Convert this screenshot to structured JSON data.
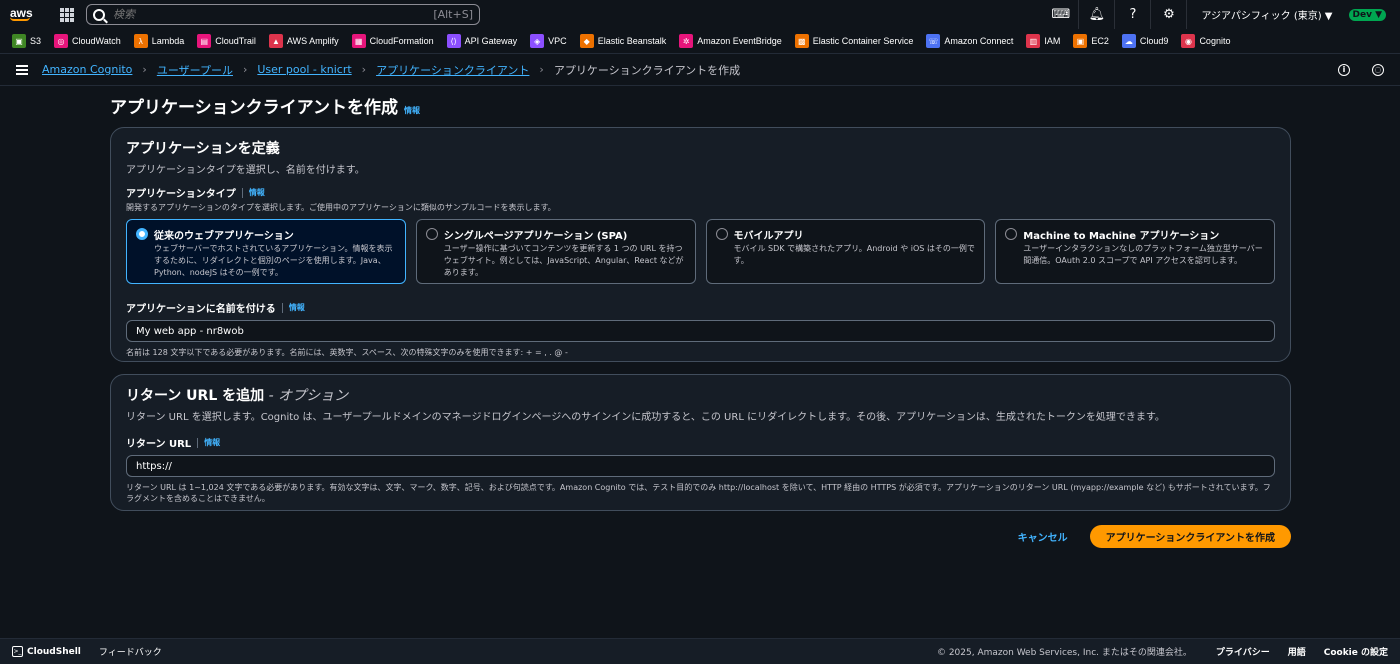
{
  "topnav": {
    "logo": "aws",
    "search_placeholder": "検索",
    "search_shortcut": "[Alt+S]",
    "region": "アジアパシフィック (東京) ▼",
    "account_badge": "Dev ▼"
  },
  "favorites": [
    {
      "label": "S3",
      "color": "#3f8624",
      "glyph": "▣"
    },
    {
      "label": "CloudWatch",
      "color": "#e7157b",
      "glyph": "◎"
    },
    {
      "label": "Lambda",
      "color": "#ed7100",
      "glyph": "λ"
    },
    {
      "label": "CloudTrail",
      "color": "#e7157b",
      "glyph": "▤"
    },
    {
      "label": "AWS Amplify",
      "color": "#dd344c",
      "glyph": "▲"
    },
    {
      "label": "CloudFormation",
      "color": "#e7157b",
      "glyph": "▦"
    },
    {
      "label": "API Gateway",
      "color": "#8c4fff",
      "glyph": "⟨⟩"
    },
    {
      "label": "VPC",
      "color": "#8c4fff",
      "glyph": "◈"
    },
    {
      "label": "Elastic Beanstalk",
      "color": "#ed7100",
      "glyph": "◆"
    },
    {
      "label": "Amazon EventBridge",
      "color": "#e7157b",
      "glyph": "✲"
    },
    {
      "label": "Elastic Container Service",
      "color": "#ed7100",
      "glyph": "▩"
    },
    {
      "label": "Amazon Connect",
      "color": "#4d72f3",
      "glyph": "☏"
    },
    {
      "label": "IAM",
      "color": "#dd344c",
      "glyph": "▥"
    },
    {
      "label": "EC2",
      "color": "#ed7100",
      "glyph": "▣"
    },
    {
      "label": "Cloud9",
      "color": "#4d72f3",
      "glyph": "☁"
    },
    {
      "label": "Cognito",
      "color": "#dd344c",
      "glyph": "◉"
    }
  ],
  "breadcrumb": {
    "items": [
      "Amazon Cognito",
      "ユーザープール",
      "User pool - knicrt",
      "アプリケーションクライアント"
    ],
    "current": "アプリケーションクライアントを作成"
  },
  "page": {
    "title": "アプリケーションクライアントを作成",
    "info": "情報"
  },
  "define_app": {
    "heading": "アプリケーションを定義",
    "description": "アプリケーションタイプを選択し、名前を付けます。",
    "type_label": "アプリケーションタイプ",
    "type_info": "情報",
    "type_description": "開発するアプリケーションのタイプを選択します。ご使用中のアプリケーションに類似のサンプルコードを表示します。",
    "tiles": [
      {
        "title": "従来のウェブアプリケーション",
        "desc": "ウェブサーバーでホストされているアプリケーション。情報を表示するために、リダイレクトと個別のページを使用します。Java、Python、nodeJS はその一例です。"
      },
      {
        "title": "シングルページアプリケーション (SPA)",
        "desc": "ユーザー操作に基づいてコンテンツを更新する 1 つの URL を持つウェブサイト。例としては、JavaScript、Angular、React などがあります。"
      },
      {
        "title": "モバイルアプリ",
        "desc": "モバイル SDK で構築されたアプリ。Android や iOS はその一例です。"
      },
      {
        "title": "Machine to Machine アプリケーション",
        "desc": "ユーザーインタラクションなしのプラットフォーム独立型サーバー間通信。OAuth 2.0 スコープで API アクセスを認可します。"
      }
    ],
    "selected_tile": 0,
    "name_label": "アプリケーションに名前を付ける",
    "name_info": "情報",
    "name_value": "My web app - nr8wob",
    "name_hint": "名前は 128 文字以下である必要があります。名前には、英数字、スペース、次の特殊文字のみを使用できます: + = , . @ -"
  },
  "return_url": {
    "heading": "リターン URL を追加",
    "heading_optional": " - オプション",
    "description": "リターン URL を選択します。Cognito は、ユーザープールドメインのマネージドログインページへのサインインに成功すると、この URL にリダイレクトします。その後、アプリケーションは、生成されたトークンを処理できます。",
    "field_label": "リターン URL",
    "field_info": "情報",
    "value": "https://",
    "hint": "リターン URL は 1~1,024 文字である必要があります。有効な文字は、文字、マーク、数字、記号、および句読点です。Amazon Cognito では、テスト目的でのみ http://localhost を除いて、HTTP 経由の HTTPS が必須です。アプリケーションのリターン URL (myapp://example など) もサポートされています。フラグメントを含めることはできません。"
  },
  "actions": {
    "cancel": "キャンセル",
    "create": "アプリケーションクライアントを作成"
  },
  "footer": {
    "cloudshell": "CloudShell",
    "feedback": "フィードバック",
    "copyright": "© 2025, Amazon Web Services, Inc. またはその関連会社。",
    "privacy": "プライバシー",
    "terms": "用語",
    "cookie": "Cookie の設定"
  }
}
